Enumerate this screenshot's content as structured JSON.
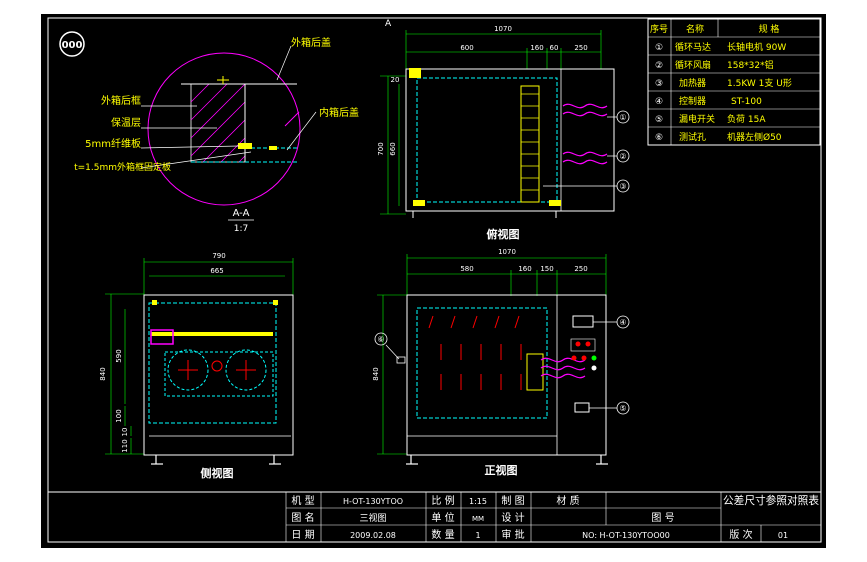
{
  "badge": "000",
  "detail": {
    "label_outer_back": "外箱后盖",
    "label_outer_frame": "外箱后框",
    "label_insulation": "保温层",
    "label_fiber": "5mm纤维板",
    "label_frame_fix": "t=1.5mm外箱框固定板",
    "label_inner_back": "内箱后盖",
    "section_letter": "A",
    "section_title": "A-A",
    "section_scale": "1:7"
  },
  "views": {
    "side_upper": "俯视图",
    "side_left": "侧视图",
    "front": "正视图"
  },
  "dims": {
    "top_overall": "1070",
    "top_a": "600",
    "top_b": "160",
    "top_c": "60",
    "top_d": "250",
    "left_h1": "700",
    "left_h2": "660",
    "left_h3": "20",
    "side_overall": "790",
    "side_inner": "665",
    "side_h1": "840",
    "side_h2": "590",
    "side_h3": "100",
    "side_h4": "10",
    "side_h5": "110",
    "front_overall": "1070",
    "front_a": "580",
    "front_b": "160",
    "front_c": "150",
    "front_d": "250",
    "front_h": "840"
  },
  "spec_table": {
    "headers": [
      "序号",
      "名称",
      "规 格"
    ],
    "rows": [
      {
        "no": "①",
        "name": "循环马达",
        "spec": "长轴电机 90W"
      },
      {
        "no": "②",
        "name": "循环风扇",
        "spec": "158*32*铝"
      },
      {
        "no": "③",
        "name": "加热器",
        "spec": "1.5KW 1支 U形"
      },
      {
        "no": "④",
        "name": "控制器",
        "spec": "ST-100"
      },
      {
        "no": "⑤",
        "name": "漏电开关",
        "spec": "负荷 15A"
      },
      {
        "no": "⑥",
        "name": "测试孔",
        "spec": "机器左侧Ø50"
      }
    ]
  },
  "callouts": [
    "①",
    "②",
    "③",
    "④",
    "⑤",
    "⑥"
  ],
  "title_block": {
    "model_label": "机 型",
    "model_value": "H-OT-130YTOO",
    "name_label": "图 名",
    "name_value": "三视图",
    "date_label": "日 期",
    "date_value": "2009.02.08",
    "scale_label": "比 例",
    "scale_value": "1:15",
    "unit_label": "单 位",
    "unit_value": "MM",
    "qty_label": "数 量",
    "qty_value": "1",
    "draw_label": "制 图",
    "design_label": "设 计",
    "review_label": "审 批",
    "material_label": "材 质",
    "drawing_no_label": "图 号",
    "drawing_no_value": "NO: H-OT-130YTOO00",
    "tolerance": "公差尺寸参照对照表",
    "version_label": "版 次",
    "version_value": "01"
  },
  "colors": {
    "background": "#000000",
    "outline": "#ffffff",
    "hidden": "#00ffff",
    "dimension": "#ffff00",
    "leader": "#00ff00",
    "detail": "#ff00ff",
    "heater": "#ff00ff",
    "red": "#ff0000"
  }
}
